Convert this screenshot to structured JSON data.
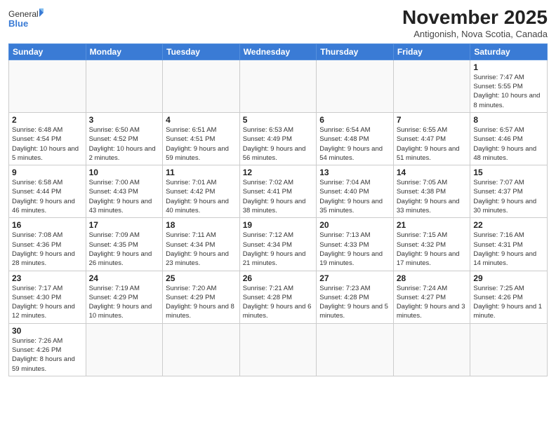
{
  "header": {
    "logo_general": "General",
    "logo_blue": "Blue",
    "month_year": "November 2025",
    "location": "Antigonish, Nova Scotia, Canada"
  },
  "weekdays": [
    "Sunday",
    "Monday",
    "Tuesday",
    "Wednesday",
    "Thursday",
    "Friday",
    "Saturday"
  ],
  "weeks": [
    [
      {
        "day": "",
        "info": ""
      },
      {
        "day": "",
        "info": ""
      },
      {
        "day": "",
        "info": ""
      },
      {
        "day": "",
        "info": ""
      },
      {
        "day": "",
        "info": ""
      },
      {
        "day": "",
        "info": ""
      },
      {
        "day": "1",
        "info": "Sunrise: 7:47 AM\nSunset: 5:55 PM\nDaylight: 10 hours and 8 minutes."
      }
    ],
    [
      {
        "day": "2",
        "info": "Sunrise: 6:48 AM\nSunset: 4:54 PM\nDaylight: 10 hours and 5 minutes."
      },
      {
        "day": "3",
        "info": "Sunrise: 6:50 AM\nSunset: 4:52 PM\nDaylight: 10 hours and 2 minutes."
      },
      {
        "day": "4",
        "info": "Sunrise: 6:51 AM\nSunset: 4:51 PM\nDaylight: 9 hours and 59 minutes."
      },
      {
        "day": "5",
        "info": "Sunrise: 6:53 AM\nSunset: 4:49 PM\nDaylight: 9 hours and 56 minutes."
      },
      {
        "day": "6",
        "info": "Sunrise: 6:54 AM\nSunset: 4:48 PM\nDaylight: 9 hours and 54 minutes."
      },
      {
        "day": "7",
        "info": "Sunrise: 6:55 AM\nSunset: 4:47 PM\nDaylight: 9 hours and 51 minutes."
      },
      {
        "day": "8",
        "info": "Sunrise: 6:57 AM\nSunset: 4:46 PM\nDaylight: 9 hours and 48 minutes."
      }
    ],
    [
      {
        "day": "9",
        "info": "Sunrise: 6:58 AM\nSunset: 4:44 PM\nDaylight: 9 hours and 46 minutes."
      },
      {
        "day": "10",
        "info": "Sunrise: 7:00 AM\nSunset: 4:43 PM\nDaylight: 9 hours and 43 minutes."
      },
      {
        "day": "11",
        "info": "Sunrise: 7:01 AM\nSunset: 4:42 PM\nDaylight: 9 hours and 40 minutes."
      },
      {
        "day": "12",
        "info": "Sunrise: 7:02 AM\nSunset: 4:41 PM\nDaylight: 9 hours and 38 minutes."
      },
      {
        "day": "13",
        "info": "Sunrise: 7:04 AM\nSunset: 4:40 PM\nDaylight: 9 hours and 35 minutes."
      },
      {
        "day": "14",
        "info": "Sunrise: 7:05 AM\nSunset: 4:38 PM\nDaylight: 9 hours and 33 minutes."
      },
      {
        "day": "15",
        "info": "Sunrise: 7:07 AM\nSunset: 4:37 PM\nDaylight: 9 hours and 30 minutes."
      }
    ],
    [
      {
        "day": "16",
        "info": "Sunrise: 7:08 AM\nSunset: 4:36 PM\nDaylight: 9 hours and 28 minutes."
      },
      {
        "day": "17",
        "info": "Sunrise: 7:09 AM\nSunset: 4:35 PM\nDaylight: 9 hours and 26 minutes."
      },
      {
        "day": "18",
        "info": "Sunrise: 7:11 AM\nSunset: 4:34 PM\nDaylight: 9 hours and 23 minutes."
      },
      {
        "day": "19",
        "info": "Sunrise: 7:12 AM\nSunset: 4:34 PM\nDaylight: 9 hours and 21 minutes."
      },
      {
        "day": "20",
        "info": "Sunrise: 7:13 AM\nSunset: 4:33 PM\nDaylight: 9 hours and 19 minutes."
      },
      {
        "day": "21",
        "info": "Sunrise: 7:15 AM\nSunset: 4:32 PM\nDaylight: 9 hours and 17 minutes."
      },
      {
        "day": "22",
        "info": "Sunrise: 7:16 AM\nSunset: 4:31 PM\nDaylight: 9 hours and 14 minutes."
      }
    ],
    [
      {
        "day": "23",
        "info": "Sunrise: 7:17 AM\nSunset: 4:30 PM\nDaylight: 9 hours and 12 minutes."
      },
      {
        "day": "24",
        "info": "Sunrise: 7:19 AM\nSunset: 4:29 PM\nDaylight: 9 hours and 10 minutes."
      },
      {
        "day": "25",
        "info": "Sunrise: 7:20 AM\nSunset: 4:29 PM\nDaylight: 9 hours and 8 minutes."
      },
      {
        "day": "26",
        "info": "Sunrise: 7:21 AM\nSunset: 4:28 PM\nDaylight: 9 hours and 6 minutes."
      },
      {
        "day": "27",
        "info": "Sunrise: 7:23 AM\nSunset: 4:28 PM\nDaylight: 9 hours and 5 minutes."
      },
      {
        "day": "28",
        "info": "Sunrise: 7:24 AM\nSunset: 4:27 PM\nDaylight: 9 hours and 3 minutes."
      },
      {
        "day": "29",
        "info": "Sunrise: 7:25 AM\nSunset: 4:26 PM\nDaylight: 9 hours and 1 minute."
      }
    ],
    [
      {
        "day": "30",
        "info": "Sunrise: 7:26 AM\nSunset: 4:26 PM\nDaylight: 8 hours and 59 minutes."
      },
      {
        "day": "",
        "info": ""
      },
      {
        "day": "",
        "info": ""
      },
      {
        "day": "",
        "info": ""
      },
      {
        "day": "",
        "info": ""
      },
      {
        "day": "",
        "info": ""
      },
      {
        "day": "",
        "info": ""
      }
    ]
  ]
}
